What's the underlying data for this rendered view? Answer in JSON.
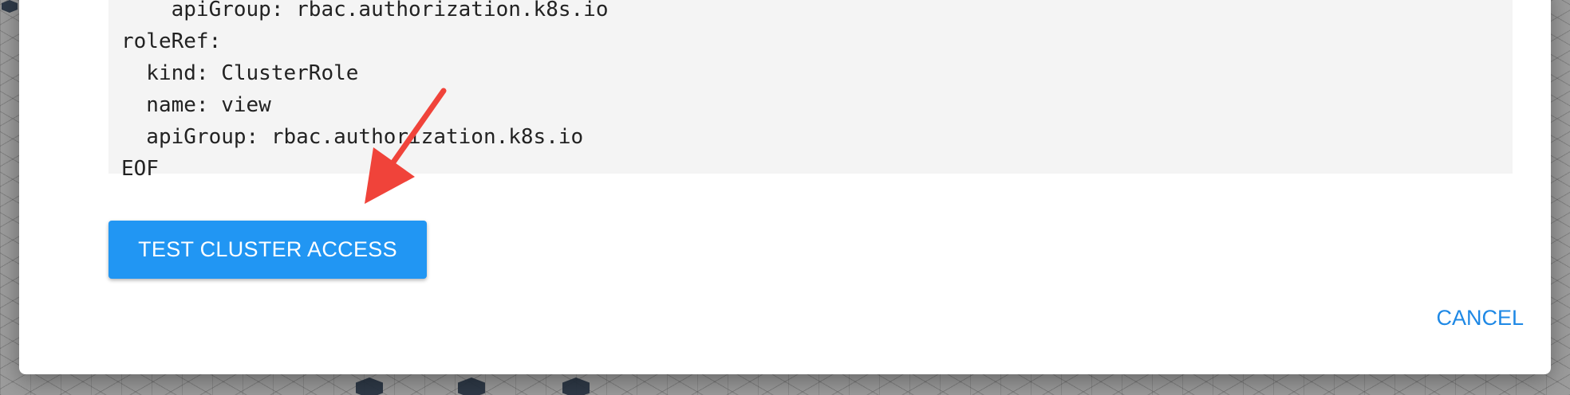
{
  "dialog": {
    "code_lines": [
      "    apiGroup: rbac.authorization.k8s.io",
      "roleRef:",
      "  kind: ClusterRole",
      "  name: view",
      "  apiGroup: rbac.authorization.k8s.io",
      "EOF"
    ],
    "primary_button_label": "TEST CLUSTER ACCESS",
    "cancel_button_label": "CANCEL"
  },
  "colors": {
    "primary": "#2196f3",
    "link": "#1e88e5",
    "annotation_arrow": "#f0433a",
    "code_background": "#f4f4f4"
  },
  "icons": {
    "annotation": "red-arrow-icon"
  }
}
